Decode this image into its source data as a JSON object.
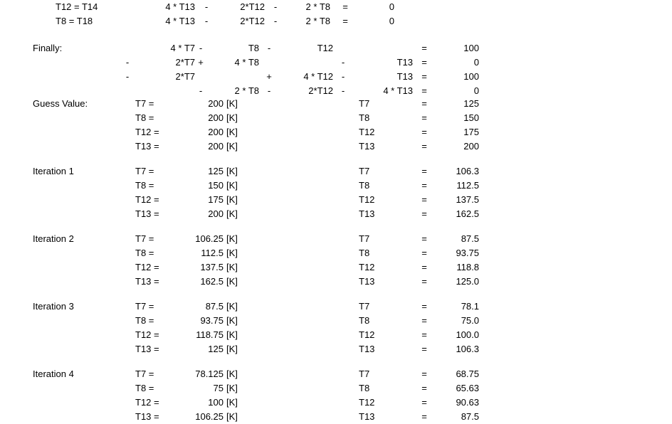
{
  "document": {
    "background_color": "#ffffff",
    "text_color": "#000000"
  },
  "equations": {
    "rows": [
      {
        "label": "T12 = T14",
        "term1": "4 * T13",
        "op1": "-",
        "term2": "2*T12",
        "op2": "-",
        "term3": "2 * T8",
        "equals": "=",
        "rhs": "0"
      },
      {
        "label": "T8 = T18",
        "term1": "4 * T13",
        "op1": "-",
        "term2": "2*T12",
        "op2": "-",
        "term3": "2 * T8",
        "equals": "=",
        "rhs": "0"
      }
    ]
  },
  "finally_block": {
    "label": "Finally:",
    "rows": [
      {
        "sign": "",
        "t7": "4 * T7",
        "op1": "-",
        "t8": "T8",
        "op2": "-",
        "t12": "T12",
        "op3": "",
        "t13": "",
        "equals": "=",
        "rhs": "100"
      },
      {
        "sign": "-",
        "t7": "2*T7",
        "op1": "+",
        "t8": "4 * T8",
        "op2": "",
        "t12": "",
        "op3": "-",
        "t13": "T13",
        "equals": "=",
        "rhs": "0"
      },
      {
        "sign": "-",
        "t7": "2*T7",
        "op1": "",
        "t8": "",
        "op2": "+",
        "t12": "4 * T12",
        "op3": "-",
        "t13": "T13",
        "equals": "=",
        "rhs": "100"
      },
      {
        "sign": "",
        "t7": "",
        "op1": "-",
        "t8": "2 *  T8",
        "op2": "-",
        "t12": "2*T12",
        "op3": "-",
        "t13": "4 * T13",
        "equals": "=",
        "rhs": "0"
      }
    ]
  },
  "blocks": [
    {
      "label": "Guess Value:",
      "rows": [
        {
          "var": "T7 =",
          "value": "200",
          "unit": "[K]",
          "var2": "T7",
          "equals": "=",
          "value2": "125"
        },
        {
          "var": "T8 =",
          "value": "200",
          "unit": "[K]",
          "var2": "T8",
          "equals": "=",
          "value2": "150"
        },
        {
          "var": "T12 =",
          "value": "200",
          "unit": "[K]",
          "var2": "T12",
          "equals": "=",
          "value2": "175"
        },
        {
          "var": "T13 =",
          "value": "200",
          "unit": "[K]",
          "var2": "T13",
          "equals": "=",
          "value2": "200"
        }
      ]
    },
    {
      "label": "Iteration 1",
      "rows": [
        {
          "var": "T7 =",
          "value": "125",
          "unit": "[K]",
          "var2": "T7",
          "equals": "=",
          "value2": "106.3"
        },
        {
          "var": "T8 =",
          "value": "150",
          "unit": "[K]",
          "var2": "T8",
          "equals": "=",
          "value2": "112.5"
        },
        {
          "var": "T12 =",
          "value": "175",
          "unit": "[K]",
          "var2": "T12",
          "equals": "=",
          "value2": "137.5"
        },
        {
          "var": "T13 =",
          "value": "200",
          "unit": "[K]",
          "var2": "T13",
          "equals": "=",
          "value2": "162.5"
        }
      ]
    },
    {
      "label": "Iteration 2",
      "rows": [
        {
          "var": "T7 =",
          "value": "106.25",
          "unit": "[K]",
          "var2": "T7",
          "equals": "=",
          "value2": "87.5"
        },
        {
          "var": "T8 =",
          "value": "112.5",
          "unit": "[K]",
          "var2": "T8",
          "equals": "=",
          "value2": "93.75"
        },
        {
          "var": "T12 =",
          "value": "137.5",
          "unit": "[K]",
          "var2": "T12",
          "equals": "=",
          "value2": "118.8"
        },
        {
          "var": "T13 =",
          "value": "162.5",
          "unit": "[K]",
          "var2": "T13",
          "equals": "=",
          "value2": "125.0"
        }
      ]
    },
    {
      "label": "Iteration 3",
      "rows": [
        {
          "var": "T7 =",
          "value": "87.5",
          "unit": "[K]",
          "var2": "T7",
          "equals": "=",
          "value2": "78.1"
        },
        {
          "var": "T8 =",
          "value": "93.75",
          "unit": "[K]",
          "var2": "T8",
          "equals": "=",
          "value2": "75.0"
        },
        {
          "var": "T12 =",
          "value": "118.75",
          "unit": "[K]",
          "var2": "T12",
          "equals": "=",
          "value2": "100.0"
        },
        {
          "var": "T13 =",
          "value": "125",
          "unit": "[K]",
          "var2": "T13",
          "equals": "=",
          "value2": "106.3"
        }
      ]
    },
    {
      "label": "Iteration 4",
      "rows": [
        {
          "var": "T7 =",
          "value": "78.125",
          "unit": "[K]",
          "var2": "T7",
          "equals": "=",
          "value2": "68.75"
        },
        {
          "var": "T8 =",
          "value": "75",
          "unit": "[K]",
          "var2": "T8",
          "equals": "=",
          "value2": "65.63"
        },
        {
          "var": "T12 =",
          "value": "100",
          "unit": "[K]",
          "var2": "T12",
          "equals": "=",
          "value2": "90.63"
        },
        {
          "var": "T13 =",
          "value": "106.25",
          "unit": "[K]",
          "var2": "T13",
          "equals": "=",
          "value2": "87.5"
        }
      ]
    }
  ]
}
